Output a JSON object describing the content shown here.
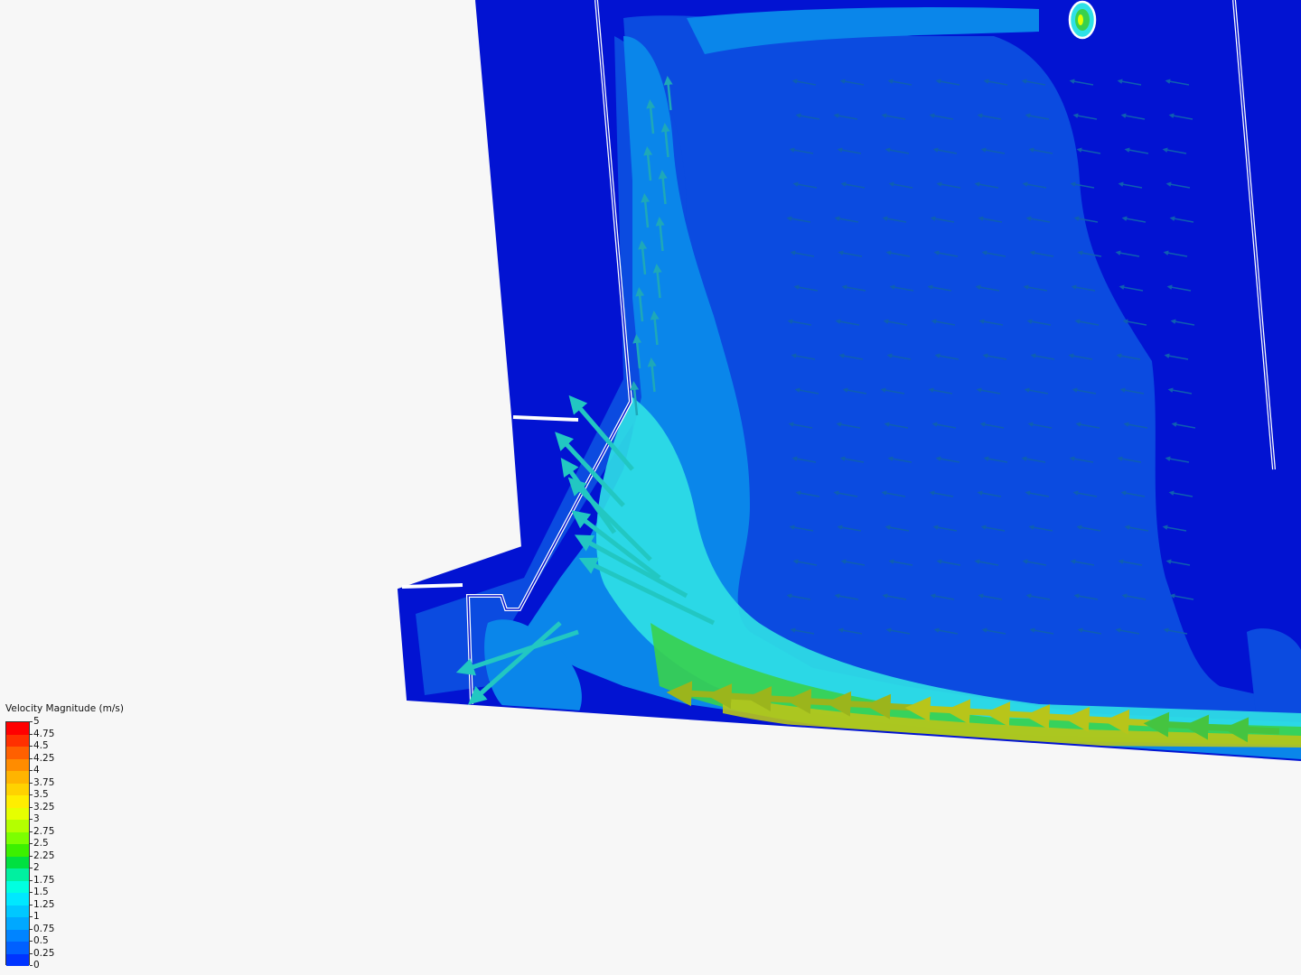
{
  "legend": {
    "title": "Velocity Magnitude (m/s)",
    "ticks": [
      "5",
      "4.75",
      "4.5",
      "4.25",
      "4",
      "3.75",
      "3.5",
      "3.25",
      "3",
      "2.75",
      "2.5",
      "2.25",
      "2",
      "1.75",
      "1.5",
      "1.25",
      "1",
      "0.75",
      "0.5",
      "0.25",
      "0"
    ],
    "colors": [
      "#ff0000",
      "#ff3000",
      "#ff6000",
      "#ff8c00",
      "#ffb400",
      "#ffd200",
      "#ffee00",
      "#e6ff00",
      "#b4ff00",
      "#7cff00",
      "#3cf000",
      "#00e040",
      "#00f0a0",
      "#00ffe0",
      "#00e8ff",
      "#00c8ff",
      "#00a8ff",
      "#0084ff",
      "#0060ff",
      "#0034ff"
    ]
  },
  "colors": {
    "background": "#f7f7f7",
    "field_base": "#0213d2",
    "low_velocity": "#0b4be0",
    "mid_velocity": "#0a86ea",
    "jet_cyan": "#2fe1e6",
    "jet_green": "#39d14c",
    "jet_yellow": "#b8c51a",
    "wall_line": "#ffffff"
  },
  "icons": [
    "arrow-glyph-icon"
  ]
}
